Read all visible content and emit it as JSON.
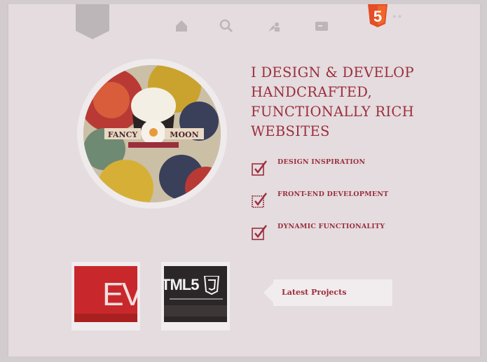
{
  "colors": {
    "accent": "#9b2e3c",
    "background": "#e4dcdf",
    "html5_orange": "#e44d26"
  },
  "nav": {
    "ribbon_text": "",
    "icons": [
      "home-icon",
      "search-icon",
      "about-icon",
      "contact-icon"
    ],
    "html5_badge": "5"
  },
  "headline": "I DESIGN & DEVELOP HANDCRAFTED, FUNCTIONALLY RICH WEBSITES",
  "features": [
    {
      "title": "DESIGN INSPIRATION",
      "icon": "checkbox-icon"
    },
    {
      "title": "FRONT-END DEVELOPMENT",
      "icon": "checkbox-icon"
    },
    {
      "title": "DYNAMIC FUNCTIONALITY",
      "icon": "checkbox-icon"
    }
  ],
  "avatar": {
    "text_left": "FANCY",
    "text_right": "MOON"
  },
  "projects": {
    "thumb1_text": "EV",
    "thumb2_text": "TML5",
    "latest_label": "Latest Projects"
  }
}
